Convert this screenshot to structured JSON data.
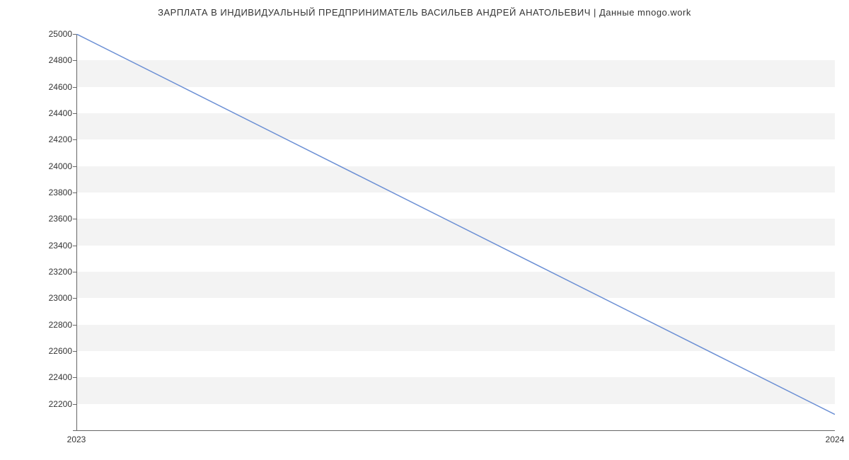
{
  "chart_data": {
    "type": "line",
    "title": "ЗАРПЛАТА В ИНДИВИДУАЛЬНЫЙ ПРЕДПРИНИМАТЕЛЬ ВАСИЛЬЕВ АНДРЕЙ АНАТОЛЬЕВИЧ | Данные mnogo.work",
    "x": [
      2023,
      2024
    ],
    "values": [
      25000,
      22120
    ],
    "xlabel": "",
    "ylabel": "",
    "ylim": [
      22000,
      25000
    ],
    "xlim": [
      2023,
      2024
    ],
    "y_ticks": [
      22000,
      22200,
      22400,
      22600,
      22800,
      23000,
      23200,
      23400,
      23600,
      23800,
      24000,
      24200,
      24400,
      24600,
      24800,
      25000
    ],
    "x_ticks": [
      2023,
      2024
    ],
    "grid": true
  },
  "colors": {
    "line": "#6b8fd4",
    "band": "#f3f3f3"
  }
}
